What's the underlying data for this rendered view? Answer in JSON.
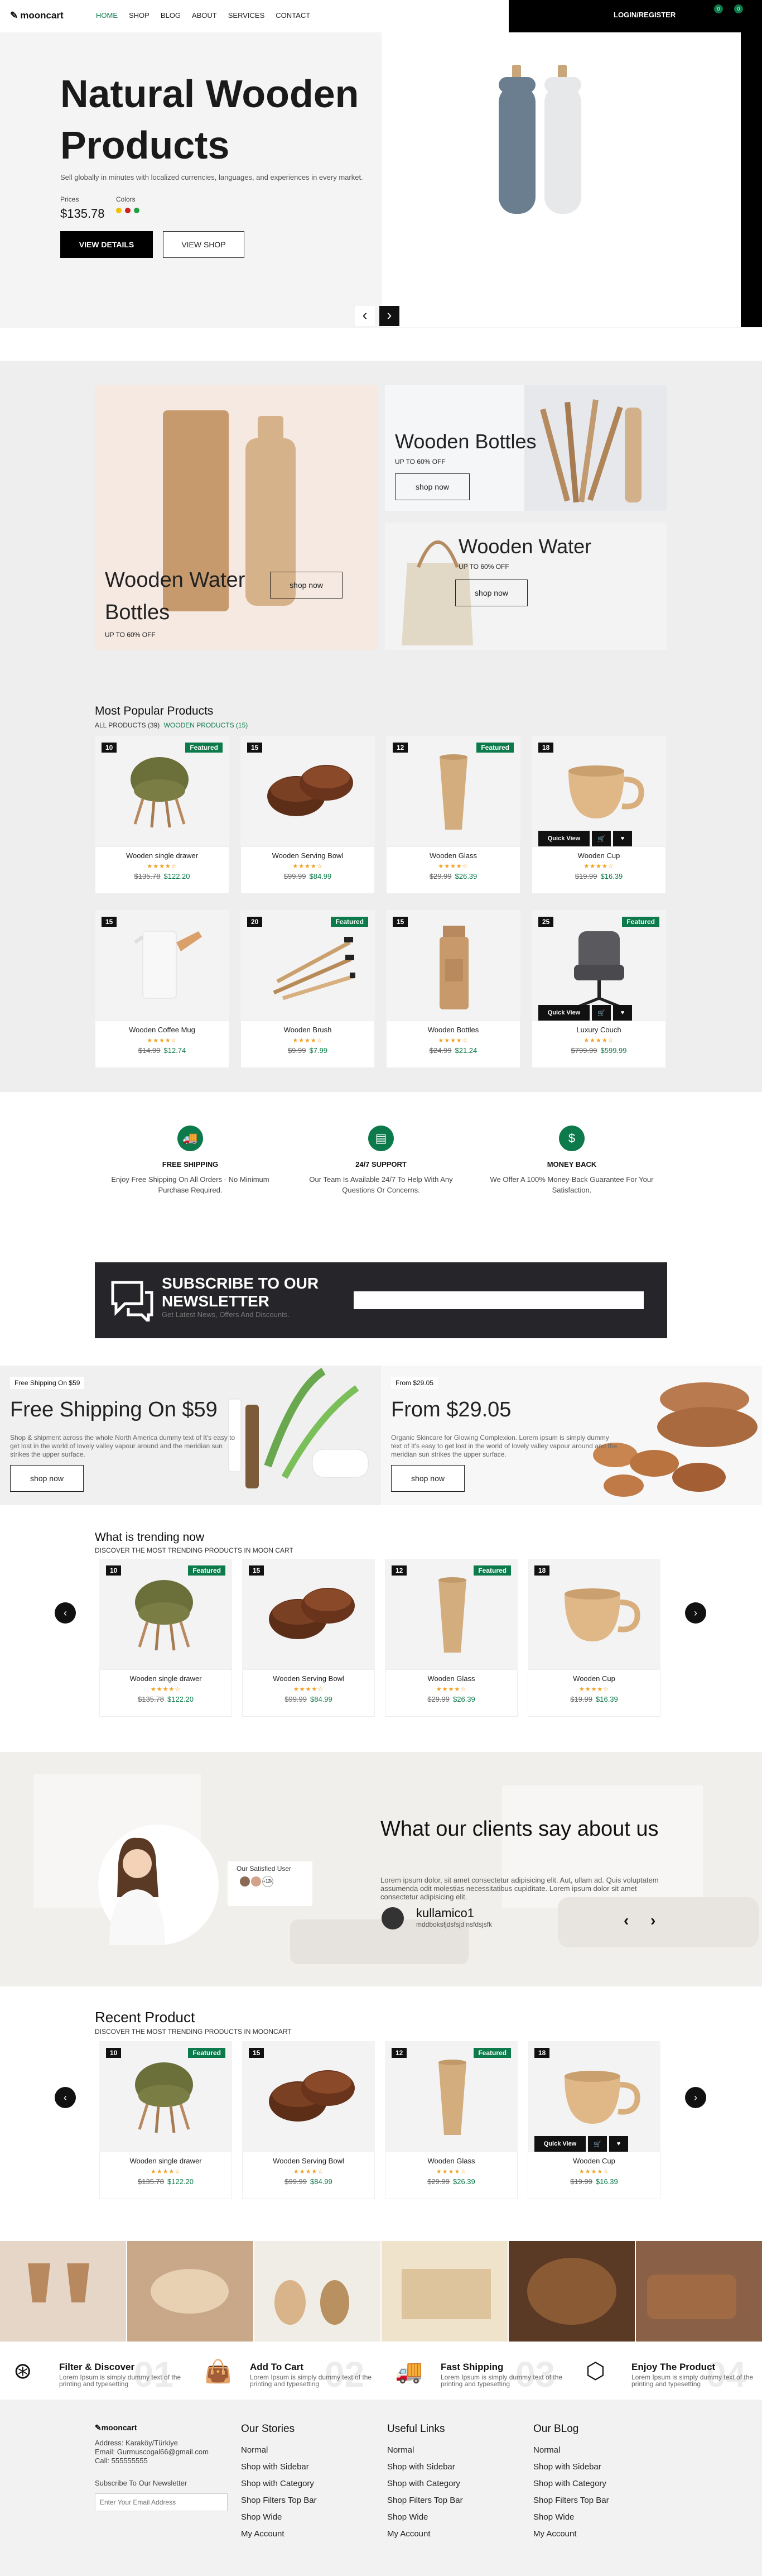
{
  "header": {
    "logo": "mooncart",
    "nav": [
      "HOME",
      "SHOP",
      "BLOG",
      "ABOUT",
      "SERVICES",
      "CONTACT"
    ],
    "login": "LOGIN/REGISTER",
    "badges": [
      "0",
      "0"
    ]
  },
  "hero": {
    "title": "Natural Wooden Products",
    "subtitle": "Sell globally in minutes with localized currencies, languages, and experiences in every market.",
    "prices_label": "Prices",
    "colors_label": "Colors",
    "price": "$135.78",
    "colors": [
      "#f0c000",
      "#d02020",
      "#20a040"
    ],
    "btn_details": "VIEW DETAILS",
    "btn_shop": "VIEW SHOP",
    "prev": "‹",
    "next": "›"
  },
  "banners": {
    "left": {
      "title": "Wooden Water Bottles",
      "sub": "UP TO 60% OFF",
      "btn": "shop now"
    },
    "tr": {
      "title": "Wooden Bottles",
      "sub": "UP TO 60% OFF",
      "btn": "shop now"
    },
    "br": {
      "title": "Wooden Water",
      "sub": "UP TO 60% OFF",
      "btn": "shop now"
    }
  },
  "popular": {
    "title": "Most Popular Products",
    "filter_all": "ALL PRODUCTS (39)",
    "filter_wood": "WOODEN PRODUCTS (15)",
    "quick_view": "Quick View",
    "items": [
      {
        "num": "10",
        "featured": "Featured",
        "name": "Wooden single drawer",
        "old": "$135.78",
        "new": "$122.20",
        "kind": "chair"
      },
      {
        "num": "15",
        "featured": "",
        "name": "Wooden Serving Bowl",
        "old": "$99.99",
        "new": "$84.99",
        "kind": "bowl"
      },
      {
        "num": "12",
        "featured": "Featured",
        "name": "Wooden Glass",
        "old": "$29.99",
        "new": "$26.39",
        "kind": "glass"
      },
      {
        "num": "18",
        "featured": "",
        "name": "Wooden Cup",
        "old": "$19.99",
        "new": "$16.39",
        "kind": "cup"
      },
      {
        "num": "15",
        "featured": "",
        "name": "Wooden Coffee Mug",
        "old": "$14.99",
        "new": "$12.74",
        "kind": "mug"
      },
      {
        "num": "20",
        "featured": "Featured",
        "name": "Wooden Brush",
        "old": "$9.99",
        "new": "$7.99",
        "kind": "brush"
      },
      {
        "num": "15",
        "featured": "",
        "name": "Wooden Bottles",
        "old": "$24.99",
        "new": "$21.24",
        "kind": "bottle"
      },
      {
        "num": "25",
        "featured": "Featured",
        "name": "Luxury Couch",
        "old": "$799.99",
        "new": "$599.99",
        "kind": "couch"
      }
    ]
  },
  "features": [
    {
      "icon": "truck-icon",
      "title": "FREE SHIPPING",
      "desc": "Enjoy Free Shipping On All Orders - No Minimum Purchase Required."
    },
    {
      "icon": "support-icon",
      "title": "24/7 SUPPORT",
      "desc": "Our Team Is Available 24/7 To Help With Any Questions Or Concerns."
    },
    {
      "icon": "money-icon",
      "title": "MONEY BACK",
      "desc": "We Offer A 100% Money-Back Guarantee For Your Satisfaction."
    }
  ],
  "newsletter": {
    "title": "SUBSCRIBE TO OUR NEWSLETTER",
    "sub": "Get Latest News, Offers And Discounts."
  },
  "promo": {
    "left": {
      "tag": "Free Shipping On $59",
      "title": "Free Shipping On $59",
      "desc": "Shop & shipment across the whole North America dummy text of It's easy to get lost in the world of lovely valley vapour around and the meridian sun strikes the upper surface.",
      "btn": "shop now"
    },
    "right": {
      "tag": "From $29.05",
      "title": "From $29.05",
      "desc": "Organic Skincare for Glowing Complexion. Lorem ipsum is simply dummy text of It's easy to get lost in the world of lovely valley vapour around and the meridian sun strikes the upper surface.",
      "btn": "shop now"
    }
  },
  "trending": {
    "title": "What is trending now",
    "sub": "DISCOVER THE MOST TRENDING PRODUCTS IN MOON CART"
  },
  "testimonial": {
    "title": "What our clients say about us",
    "text": "Lorem ipsum dolor, sit amet consectetur adipisicing elit. Aut, ullam ad. Quis voluptatem assumenda odit molestias necessitatibus cupiditate. Lorem ipsum dolor sit amet consectetur adipisicing elit.",
    "name": "kullamico1",
    "role": "mddboksfjdsfsjd nsfdsjsfk",
    "satisfied": "Our Satisfied User",
    "count": "+12k",
    "prev": "‹",
    "next": "›"
  },
  "recent": {
    "title": "Recent Product",
    "sub": "DISCOVER THE MOST TRENDING PRODUCTS IN MOONCART"
  },
  "services": [
    {
      "num": "01",
      "title": "Filter & Discover",
      "desc": "Lorem Ipsum is simply dummy text of the printing and typesetting"
    },
    {
      "num": "02",
      "title": "Add To Cart",
      "desc": "Lorem Ipsum is simply dummy text of the printing and typesetting"
    },
    {
      "num": "03",
      "title": "Fast Shipping",
      "desc": "Lorem Ipsum is simply dummy text of the printing and typesetting"
    },
    {
      "num": "04",
      "title": "Enjoy The Product",
      "desc": "Lorem Ipsum is simply dummy text of the printing and typesetting"
    }
  ],
  "footer": {
    "logo": "mooncart",
    "address": "Address: Karaköy/Türkiye",
    "email": "Email: Gurmuscogal66@gmail.com",
    "call": "Call: 555555555",
    "subscribe": "Subscribe To Our Newsletter",
    "email_placeholder": "Enter Your Email Address",
    "cols": [
      {
        "title": "Our Stories",
        "items": [
          "Normal",
          "Shop with Sidebar",
          "Shop with Category",
          "Shop Filters Top Bar",
          "Shop Wide",
          "My Account"
        ]
      },
      {
        "title": "Useful Links",
        "items": [
          "Normal",
          "Shop with Sidebar",
          "Shop with Category",
          "Shop Filters Top Bar",
          "Shop Wide",
          "My Account"
        ]
      },
      {
        "title": "Our BLog",
        "items": [
          "Normal",
          "Shop with Sidebar",
          "Shop with Category",
          "Shop Filters Top Bar",
          "Shop Wide",
          "My Account"
        ]
      }
    ]
  }
}
